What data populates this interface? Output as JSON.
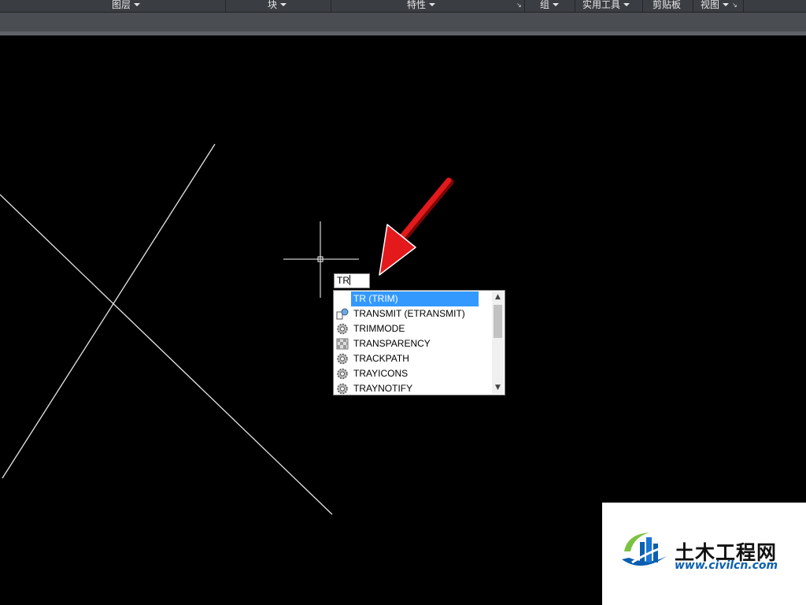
{
  "ribbon": {
    "panels": [
      {
        "label": "图层",
        "dropdown": true
      },
      {
        "label": "块",
        "dropdown": true
      },
      {
        "label": "特性",
        "dropdown": true,
        "launcher": true
      },
      {
        "label": "组",
        "dropdown": true
      },
      {
        "label": "实用工具",
        "dropdown": true
      },
      {
        "label": "剪贴板",
        "dropdown": false
      },
      {
        "label": "视图",
        "dropdown": true,
        "launcher": true
      }
    ]
  },
  "command_input": {
    "value": "TR"
  },
  "autocomplete": {
    "items": [
      {
        "label": "TR (TRIM)",
        "icon": "trim-icon",
        "selected": true
      },
      {
        "label": "TRANSMIT (ETRANSMIT)",
        "icon": "etransmit-icon",
        "selected": false
      },
      {
        "label": "TRIMMODE",
        "icon": "system-variable-gear-icon",
        "selected": false
      },
      {
        "label": "TRANSPARENCY",
        "icon": "transparency-icon",
        "selected": false
      },
      {
        "label": "TRACKPATH",
        "icon": "system-variable-gear-icon",
        "selected": false
      },
      {
        "label": "TRAYICONS",
        "icon": "system-variable-gear-icon",
        "selected": false
      },
      {
        "label": "TRAYNOTIFY",
        "icon": "system-variable-gear-icon",
        "selected": false
      }
    ],
    "scroll_up_icon": "chevron-up-icon",
    "scroll_down_icon": "chevron-down-icon"
  },
  "watermark": {
    "title": "土木工程网",
    "url": "www.civilcn.com"
  },
  "colors": {
    "canvas_background": "#000000",
    "drawing_lines": "#e6e6e6",
    "selection_highlight": "#3399ff",
    "annotation_arrow": "#e3191c",
    "ribbon_background": "#3a3d42",
    "logo_blue": "#0b5fb0",
    "logo_green": "#7cc242"
  }
}
